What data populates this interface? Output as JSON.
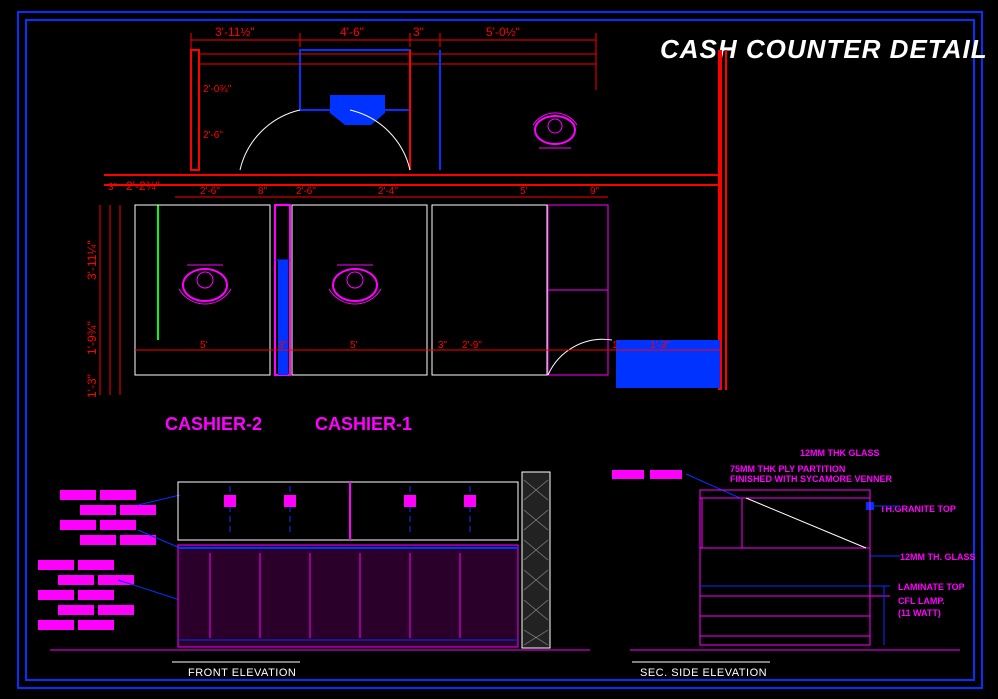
{
  "title": "CASH COUNTER DETAIL",
  "plan": {
    "top_dims": [
      "3'-11½\"",
      "4'-6\"",
      "3\"",
      "5'-0½\""
    ],
    "top_row2": [
      "2'-0¾\"",
      "2'-6\""
    ],
    "mid_dims_left": [
      "3\"",
      "2'-2¾\""
    ],
    "mid_dims": [
      "2'-6\"",
      "8\"",
      "2'-6\"",
      "2'-4\"",
      "5'",
      "9\""
    ],
    "left_dims": [
      "3'-11¼\"",
      "1'-9¾\"",
      "1'-3\""
    ],
    "bottom_dims": [
      "5'",
      "3\"",
      "5'",
      "3\"",
      "2'-9\"",
      "1'",
      "1'-3\""
    ],
    "labels": {
      "cashier2": "CASHIER-2",
      "cashier1": "CASHIER-1"
    }
  },
  "elevations": {
    "front": "FRONT ELEVATION",
    "side": "SEC. SIDE ELEVATION"
  },
  "notes": {
    "glass12a": "12MM THK GLASS",
    "ply": "75MM THK PLY PARTITION",
    "ply2": "FINISHED WITH SYCAMORE VENNER",
    "granite": "TH.GRANITE TOP",
    "glass12b": "12MM TH. GLASS",
    "laminate": "LAMINATE TOP",
    "cfl": "CFL LAMP.",
    "cfl2": "(11 WATT)"
  }
}
